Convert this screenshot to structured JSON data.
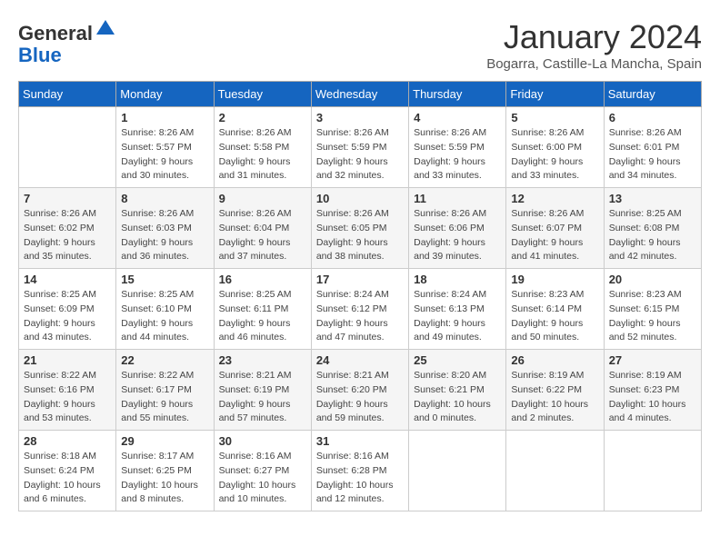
{
  "header": {
    "logo_general": "General",
    "logo_blue": "Blue",
    "month_title": "January 2024",
    "location": "Bogarra, Castille-La Mancha, Spain"
  },
  "days_of_week": [
    "Sunday",
    "Monday",
    "Tuesday",
    "Wednesday",
    "Thursday",
    "Friday",
    "Saturday"
  ],
  "weeks": [
    [
      {
        "day": "",
        "info": ""
      },
      {
        "day": "1",
        "info": "Sunrise: 8:26 AM\nSunset: 5:57 PM\nDaylight: 9 hours\nand 30 minutes."
      },
      {
        "day": "2",
        "info": "Sunrise: 8:26 AM\nSunset: 5:58 PM\nDaylight: 9 hours\nand 31 minutes."
      },
      {
        "day": "3",
        "info": "Sunrise: 8:26 AM\nSunset: 5:59 PM\nDaylight: 9 hours\nand 32 minutes."
      },
      {
        "day": "4",
        "info": "Sunrise: 8:26 AM\nSunset: 5:59 PM\nDaylight: 9 hours\nand 33 minutes."
      },
      {
        "day": "5",
        "info": "Sunrise: 8:26 AM\nSunset: 6:00 PM\nDaylight: 9 hours\nand 33 minutes."
      },
      {
        "day": "6",
        "info": "Sunrise: 8:26 AM\nSunset: 6:01 PM\nDaylight: 9 hours\nand 34 minutes."
      }
    ],
    [
      {
        "day": "7",
        "info": "Sunrise: 8:26 AM\nSunset: 6:02 PM\nDaylight: 9 hours\nand 35 minutes."
      },
      {
        "day": "8",
        "info": "Sunrise: 8:26 AM\nSunset: 6:03 PM\nDaylight: 9 hours\nand 36 minutes."
      },
      {
        "day": "9",
        "info": "Sunrise: 8:26 AM\nSunset: 6:04 PM\nDaylight: 9 hours\nand 37 minutes."
      },
      {
        "day": "10",
        "info": "Sunrise: 8:26 AM\nSunset: 6:05 PM\nDaylight: 9 hours\nand 38 minutes."
      },
      {
        "day": "11",
        "info": "Sunrise: 8:26 AM\nSunset: 6:06 PM\nDaylight: 9 hours\nand 39 minutes."
      },
      {
        "day": "12",
        "info": "Sunrise: 8:26 AM\nSunset: 6:07 PM\nDaylight: 9 hours\nand 41 minutes."
      },
      {
        "day": "13",
        "info": "Sunrise: 8:25 AM\nSunset: 6:08 PM\nDaylight: 9 hours\nand 42 minutes."
      }
    ],
    [
      {
        "day": "14",
        "info": "Sunrise: 8:25 AM\nSunset: 6:09 PM\nDaylight: 9 hours\nand 43 minutes."
      },
      {
        "day": "15",
        "info": "Sunrise: 8:25 AM\nSunset: 6:10 PM\nDaylight: 9 hours\nand 44 minutes."
      },
      {
        "day": "16",
        "info": "Sunrise: 8:25 AM\nSunset: 6:11 PM\nDaylight: 9 hours\nand 46 minutes."
      },
      {
        "day": "17",
        "info": "Sunrise: 8:24 AM\nSunset: 6:12 PM\nDaylight: 9 hours\nand 47 minutes."
      },
      {
        "day": "18",
        "info": "Sunrise: 8:24 AM\nSunset: 6:13 PM\nDaylight: 9 hours\nand 49 minutes."
      },
      {
        "day": "19",
        "info": "Sunrise: 8:23 AM\nSunset: 6:14 PM\nDaylight: 9 hours\nand 50 minutes."
      },
      {
        "day": "20",
        "info": "Sunrise: 8:23 AM\nSunset: 6:15 PM\nDaylight: 9 hours\nand 52 minutes."
      }
    ],
    [
      {
        "day": "21",
        "info": "Sunrise: 8:22 AM\nSunset: 6:16 PM\nDaylight: 9 hours\nand 53 minutes."
      },
      {
        "day": "22",
        "info": "Sunrise: 8:22 AM\nSunset: 6:17 PM\nDaylight: 9 hours\nand 55 minutes."
      },
      {
        "day": "23",
        "info": "Sunrise: 8:21 AM\nSunset: 6:19 PM\nDaylight: 9 hours\nand 57 minutes."
      },
      {
        "day": "24",
        "info": "Sunrise: 8:21 AM\nSunset: 6:20 PM\nDaylight: 9 hours\nand 59 minutes."
      },
      {
        "day": "25",
        "info": "Sunrise: 8:20 AM\nSunset: 6:21 PM\nDaylight: 10 hours\nand 0 minutes."
      },
      {
        "day": "26",
        "info": "Sunrise: 8:19 AM\nSunset: 6:22 PM\nDaylight: 10 hours\nand 2 minutes."
      },
      {
        "day": "27",
        "info": "Sunrise: 8:19 AM\nSunset: 6:23 PM\nDaylight: 10 hours\nand 4 minutes."
      }
    ],
    [
      {
        "day": "28",
        "info": "Sunrise: 8:18 AM\nSunset: 6:24 PM\nDaylight: 10 hours\nand 6 minutes."
      },
      {
        "day": "29",
        "info": "Sunrise: 8:17 AM\nSunset: 6:25 PM\nDaylight: 10 hours\nand 8 minutes."
      },
      {
        "day": "30",
        "info": "Sunrise: 8:16 AM\nSunset: 6:27 PM\nDaylight: 10 hours\nand 10 minutes."
      },
      {
        "day": "31",
        "info": "Sunrise: 8:16 AM\nSunset: 6:28 PM\nDaylight: 10 hours\nand 12 minutes."
      },
      {
        "day": "",
        "info": ""
      },
      {
        "day": "",
        "info": ""
      },
      {
        "day": "",
        "info": ""
      }
    ]
  ]
}
